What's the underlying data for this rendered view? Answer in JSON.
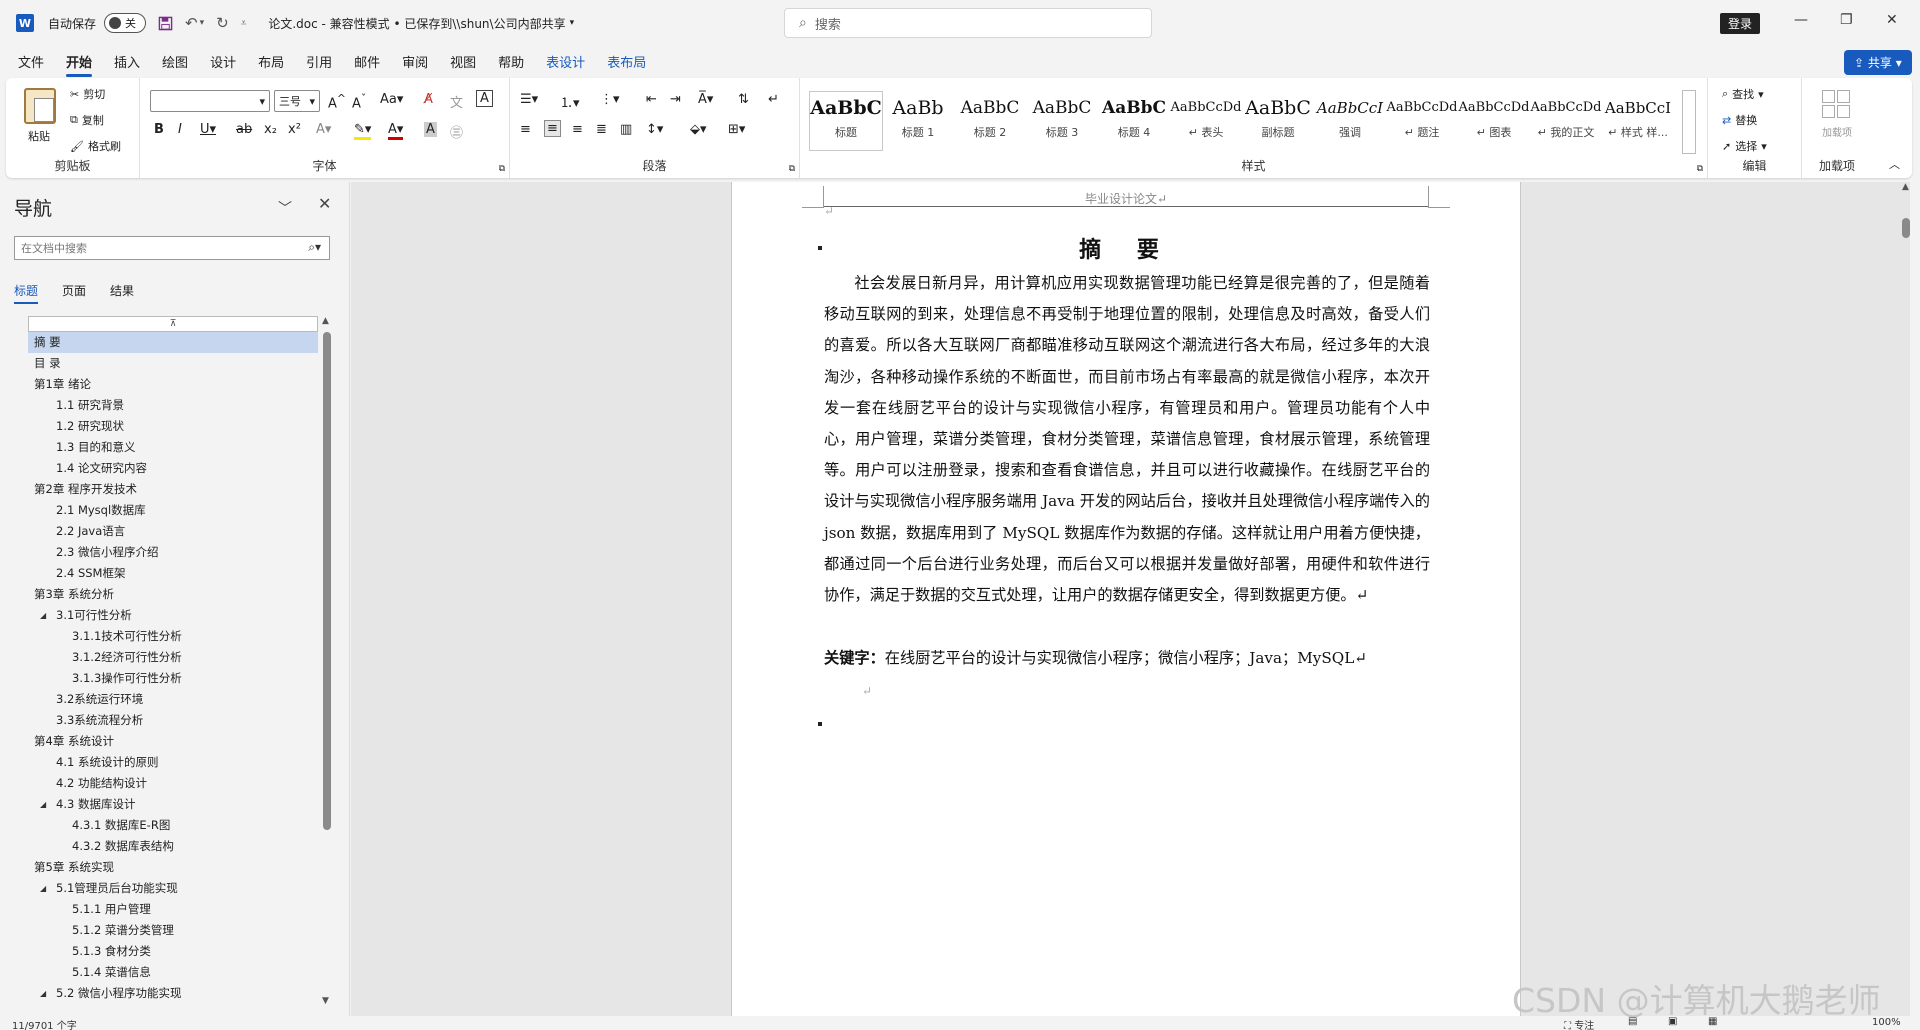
{
  "titlebar": {
    "app_icon": "word-icon",
    "autosave_label": "自动保存",
    "autosave_state": "关",
    "doc_title": "论文.doc  -  兼容性模式 • 已保存到\\\\shun\\公司内部共享",
    "search_placeholder": "搜索",
    "login_label": "登录"
  },
  "menu": {
    "items": [
      "文件",
      "开始",
      "插入",
      "绘图",
      "设计",
      "布局",
      "引用",
      "邮件",
      "审阅",
      "视图",
      "帮助",
      "表设计",
      "表布局"
    ],
    "share_label": "共享"
  },
  "ribbon": {
    "clipboard": {
      "paste": "粘贴",
      "cut": "剪切",
      "copy": "复制",
      "format_painter": "格式刷",
      "group_label": "剪贴板"
    },
    "font": {
      "font_name": "",
      "font_size": "三号",
      "group_label": "字体"
    },
    "paragraph": {
      "group_label": "段落"
    },
    "styles": {
      "group_label": "样式",
      "items": [
        {
          "preview": "AaBbC",
          "name": "标题"
        },
        {
          "preview": "AaBb",
          "name": "标题 1"
        },
        {
          "preview": "AaBbC",
          "name": "标题 2"
        },
        {
          "preview": "AaBbC",
          "name": "标题 3"
        },
        {
          "preview": "AaBbC",
          "name": "标题 4"
        },
        {
          "preview": "AaBbCcDd",
          "name": "↵ 表头"
        },
        {
          "preview": "AaBbC",
          "name": "副标题"
        },
        {
          "preview": "AaBbCcI",
          "name": "强调"
        },
        {
          "preview": "AaBbCcDd",
          "name": "↵ 题注"
        },
        {
          "preview": "AaBbCcDd",
          "name": "↵ 图表"
        },
        {
          "preview": "AaBbCcDd",
          "name": "↵ 我的正文"
        },
        {
          "preview": "AaBbCcI",
          "name": "↵ 样式 样..."
        }
      ]
    },
    "editing": {
      "find": "查找",
      "replace": "替换",
      "select": "选择",
      "group_label": "编辑"
    },
    "addins": {
      "button": "加载项",
      "group_label": "加载项"
    }
  },
  "nav": {
    "title": "导航",
    "search_placeholder": "在文档中搜索",
    "tabs": [
      "标题",
      "页面",
      "结果"
    ],
    "tree": [
      {
        "label": "摘  要",
        "level": 0,
        "selected": true,
        "expander": false
      },
      {
        "label": "目  录",
        "level": 0,
        "expander": false
      },
      {
        "label": "第1章 绪论",
        "level": 0,
        "expander": true
      },
      {
        "label": "1.1 研究背景",
        "level": 1,
        "expander": false
      },
      {
        "label": "1.2 研究现状",
        "level": 1,
        "expander": false
      },
      {
        "label": "1.3 目的和意义",
        "level": 1,
        "expander": false
      },
      {
        "label": "1.4 论文研究内容",
        "level": 1,
        "expander": false
      },
      {
        "label": "第2章 程序开发技术",
        "level": 0,
        "expander": true
      },
      {
        "label": "2.1 Mysql数据库",
        "level": 1,
        "expander": false
      },
      {
        "label": "2.2 Java语言",
        "level": 1,
        "expander": false
      },
      {
        "label": "2.3 微信小程序介绍",
        "level": 1,
        "expander": false
      },
      {
        "label": "2.4 SSM框架",
        "level": 1,
        "expander": false
      },
      {
        "label": "第3章 系统分析",
        "level": 0,
        "expander": true
      },
      {
        "label": "3.1可行性分析",
        "level": 1,
        "expander": true
      },
      {
        "label": "3.1.1技术可行性分析",
        "level": 2,
        "expander": false
      },
      {
        "label": "3.1.2经济可行性分析",
        "level": 2,
        "expander": false
      },
      {
        "label": "3.1.3操作可行性分析",
        "level": 2,
        "expander": false
      },
      {
        "label": "3.2系统运行环境",
        "level": 1,
        "expander": false
      },
      {
        "label": "3.3系统流程分析",
        "level": 1,
        "expander": false
      },
      {
        "label": "第4章 系统设计",
        "level": 0,
        "expander": true
      },
      {
        "label": "4.1 系统设计的原则",
        "level": 1,
        "expander": false
      },
      {
        "label": "4.2 功能结构设计",
        "level": 1,
        "expander": false
      },
      {
        "label": "4.3 数据库设计",
        "level": 1,
        "expander": true
      },
      {
        "label": "4.3.1 数据库E-R图",
        "level": 2,
        "expander": false
      },
      {
        "label": "4.3.2 数据库表结构",
        "level": 2,
        "expander": false
      },
      {
        "label": "第5章 系统实现",
        "level": 0,
        "expander": true
      },
      {
        "label": "5.1管理员后台功能实现",
        "level": 1,
        "expander": true
      },
      {
        "label": "5.1.1 用户管理",
        "level": 2,
        "expander": false
      },
      {
        "label": "5.1.2 菜谱分类管理",
        "level": 2,
        "expander": false
      },
      {
        "label": "5.1.3 食材分类",
        "level": 2,
        "expander": false
      },
      {
        "label": "5.1.4 菜谱信息",
        "level": 2,
        "expander": false
      },
      {
        "label": "5.2 微信小程序功能实现",
        "level": 1,
        "expander": true
      }
    ]
  },
  "document": {
    "header": "毕业设计论文↵",
    "heading": "摘  要",
    "body": "社会发展日新月异，用计算机应用实现数据管理功能已经算是很完善的了，但是随着移动互联网的到来，处理信息不再受制于地理位置的限制，处理信息及时高效，备受人们的喜爱。所以各大互联网厂商都瞄准移动互联网这个潮流进行各大布局，经过多年的大浪淘沙，各种移动操作系统的不断面世，而目前市场占有率最高的就是微信小程序，本次开发一套在线厨艺平台的设计与实现微信小程序，有管理员和用户。管理员功能有个人中心，用户管理，菜谱分类管理，食材分类管理，菜谱信息管理，食材展示管理，系统管理等。用户可以注册登录，搜索和查看食谱信息，并且可以进行收藏操作。在线厨艺平台的设计与实现微信小程序服务端用 Java 开发的网站后台，接收并且处理微信小程序端传入的 json 数据，数据库用到了 MySQL 数据库作为数据的存储。这样就让用户用着方便快捷，都通过同一个后台进行业务处理，而后台又可以根据并发量做好部署，用硬件和软件进行协作，满足于数据的交互式处理，让用户的数据存储更安全，得到数据更方便。↵",
    "keywords_label": "关键字：",
    "keywords": "在线厨艺平台的设计与实现微信小程序；微信小程序；Java；MySQL↵",
    "empty_mark": "↵"
  },
  "statusbar": {
    "word_count": "11/9701 个字",
    "focus": "专注",
    "zoom": "100%"
  },
  "watermark": "CSDN @计算机大鹅老师",
  "colors": {
    "accent": "#185abd",
    "nav_selected": "#c5d6ee",
    "save_icon": "#7a2d8c"
  }
}
